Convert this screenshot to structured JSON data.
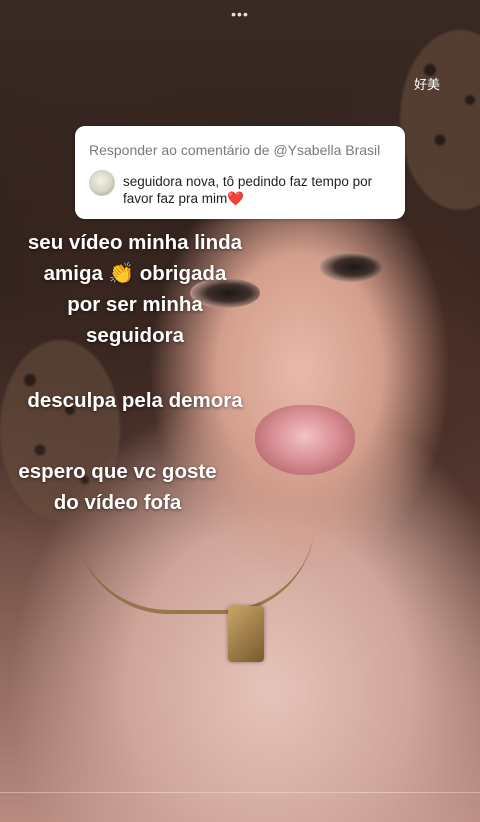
{
  "top": {
    "menu_icon": "more-horizontal-icon",
    "menu_glyph": "•••",
    "corner_text": "好美"
  },
  "reply": {
    "header": "Responder ao comentário de @Ysabella Brasil",
    "comment": "seguidora nova, tô pedindo faz tempo por favor faz pra mim",
    "emoji": "❤️"
  },
  "captions": {
    "block1": {
      "line1": "seu vídeo minha linda",
      "line2": "amiga 👏 obrigada",
      "line3": "por ser minha",
      "line4": "seguidora"
    },
    "block2": {
      "line1": "desculpa pela demora"
    },
    "block3": {
      "line1": "espero que vc goste",
      "line2": "do vídeo fofa"
    }
  }
}
